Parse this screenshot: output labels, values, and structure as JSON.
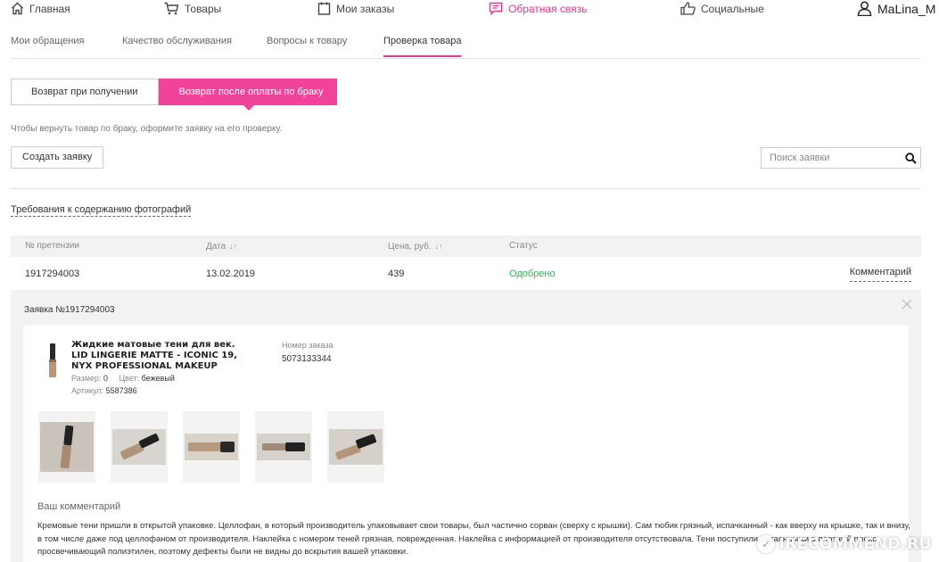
{
  "topnav": {
    "items": [
      {
        "label": "Главная",
        "icon": "home-icon"
      },
      {
        "label": "Товары",
        "icon": "cart-icon"
      },
      {
        "label": "Мои заказы",
        "icon": "orders-icon"
      },
      {
        "label": "Обратная связь",
        "icon": "feedback-icon"
      },
      {
        "label": "Социальные",
        "icon": "like-icon"
      }
    ],
    "user": "MaLina_M",
    "accent_color": "#e8368f"
  },
  "subtabs": [
    "Мои обращения",
    "Качество обслуживания",
    "Вопросы к товару",
    "Проверка товара"
  ],
  "return_type": {
    "options": [
      "Возврат при получении",
      "Возврат после оплаты по браку"
    ],
    "selected": "Возврат после оплаты по браку"
  },
  "hint": "Чтобы вернуть товар по браку, оформите заявку на его проверку.",
  "create_button": "Создать заявку",
  "search": {
    "placeholder": "Поиск заявки"
  },
  "photo_requirements_link": "Требования к содержанию фотографий",
  "table": {
    "headers": [
      "№ претензии",
      "Дата",
      "Цена, руб.",
      "Статус"
    ],
    "row": {
      "claim": "1917294003",
      "date": "13.02.2019",
      "price": "439",
      "status": "Одобрено",
      "comment_link": "Комментарий"
    },
    "status_color": "#2db45a"
  },
  "detail": {
    "title": "Заявка №1917294003",
    "product": {
      "name": "Жидкие матовые тени для век. LID LINGERIE MATTE - ICONIC 19, NYX PROFESSIONAL MAKEUP",
      "size_label": "Размер:",
      "size": "0",
      "color_label": "Цвет:",
      "color": "бежевый",
      "article_label": "Артикул:",
      "article": "5587386"
    },
    "order_label": "Номер заказа",
    "order_number": "5073133344",
    "photos_count": 5,
    "comment_title": "Ваш комментарий",
    "comment_text": "Кремовые тени пришли в открытой упаковке. Целлофан, в который производитель упаковывает свои товары, был частично сорван (сверху с крышки). Сам тюбик грязный, испачканный - как вверху на крышке, так и внизу, в том числе даже под целлофаном от производителя. Наклейка с номером теней грязная, поврежденная. Наклейка с информацией от производителя отсутствовала. Тени поступили запаянными в плотный плохо просвечивающий полиэтилен, поэтому дефекты были не видны до вскрытия вашей упаковки."
  },
  "watermark": "IRECOMMEND.RU"
}
